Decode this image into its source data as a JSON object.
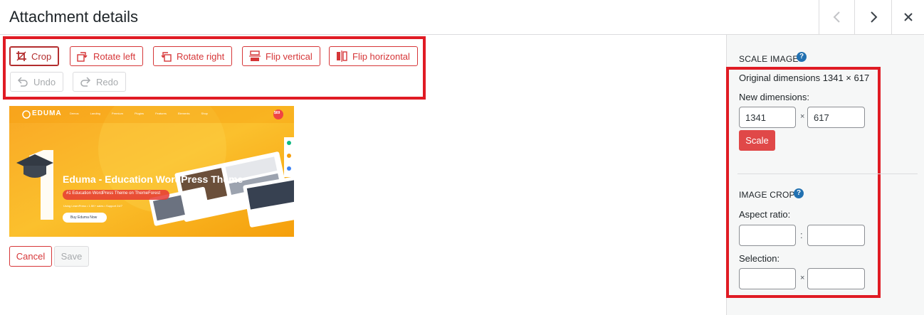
{
  "header": {
    "title": "Attachment details"
  },
  "toolbar": {
    "crop": "Crop",
    "rotate_left": "Rotate left",
    "rotate_right": "Rotate right",
    "flip_vertical": "Flip vertical",
    "flip_horizontal": "Flip horizontal",
    "undo": "Undo",
    "redo": "Redo"
  },
  "preview": {
    "logo": "EDUMA",
    "nav_items": [
      "Demos",
      "Landing",
      "Premium",
      "Plugins",
      "Features",
      "Elements",
      "Shop"
    ],
    "headline": "Eduma - Education WordPress Theme",
    "subline": "#1 Education WordPress Theme on ThemeForest",
    "fine_print": "Using LearnPress • 1.5K+ sales • Support 24/7",
    "cta": "Buy Eduma Now",
    "badge": "$69",
    "big_numeral": "1"
  },
  "footer": {
    "cancel": "Cancel",
    "save": "Save"
  },
  "sidebar": {
    "scale_title": "SCALE IMAGE",
    "help_glyph": "?",
    "original_dimensions": "Original dimensions 1341 × 617",
    "new_dimensions_label": "New dimensions:",
    "width_value": "1341",
    "height_value": "617",
    "times": "×",
    "scale_button": "Scale",
    "crop_title": "IMAGE CROP",
    "aspect_label": "Aspect ratio:",
    "colon": ":",
    "selection_label": "Selection:"
  },
  "colors": {
    "accent_red": "#d63638",
    "highlight_red": "#e01b24",
    "scale_button": "#e04848",
    "help_blue": "#2271b1"
  },
  "icons": [
    "chevron-left-icon",
    "chevron-right-icon",
    "close-icon",
    "crop-icon",
    "rotate-left-icon",
    "rotate-right-icon",
    "flip-vertical-icon",
    "flip-horizontal-icon",
    "undo-icon",
    "redo-icon",
    "help-icon"
  ]
}
